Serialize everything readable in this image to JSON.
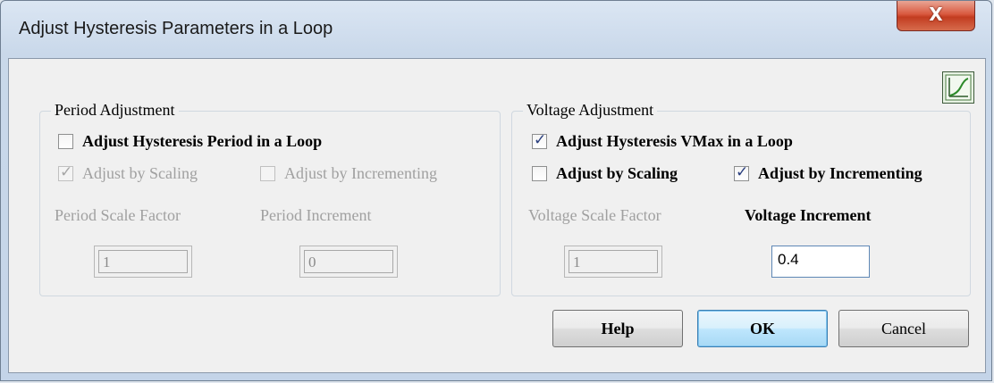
{
  "window": {
    "title": "Adjust Hysteresis Parameters in a Loop",
    "close_glyph": "X"
  },
  "icons": {
    "graph": "graph-icon",
    "close": "close-icon"
  },
  "period": {
    "legend": "Period Adjustment",
    "loop_checkbox": {
      "label": "Adjust Hysteresis Period in a Loop",
      "checked": false
    },
    "scaling_checkbox": {
      "label": "Adjust by Scaling",
      "checked": true,
      "enabled": false
    },
    "incrementing_checkbox": {
      "label": "Adjust by Incrementing",
      "checked": false,
      "enabled": false
    },
    "scale_factor_label": "Period Scale Factor",
    "scale_factor_value": "1",
    "increment_label": "Period Increment",
    "increment_value": "0"
  },
  "voltage": {
    "legend": "Voltage Adjustment",
    "loop_checkbox": {
      "label": "Adjust Hysteresis VMax in a Loop",
      "checked": true
    },
    "scaling_checkbox": {
      "label": "Adjust by Scaling",
      "checked": false,
      "enabled": true
    },
    "incrementing_checkbox": {
      "label": "Adjust by Incrementing",
      "checked": true,
      "enabled": true
    },
    "scale_factor_label": "Voltage Scale Factor",
    "scale_factor_value": "1",
    "increment_label": "Voltage Increment",
    "increment_value": "0.4"
  },
  "buttons": {
    "help": "Help",
    "ok": "OK",
    "cancel": "Cancel"
  },
  "colors": {
    "close_button": "#c23c20",
    "check_tick": "#2a3f7e",
    "default_button_border": "#3c7fb1"
  }
}
